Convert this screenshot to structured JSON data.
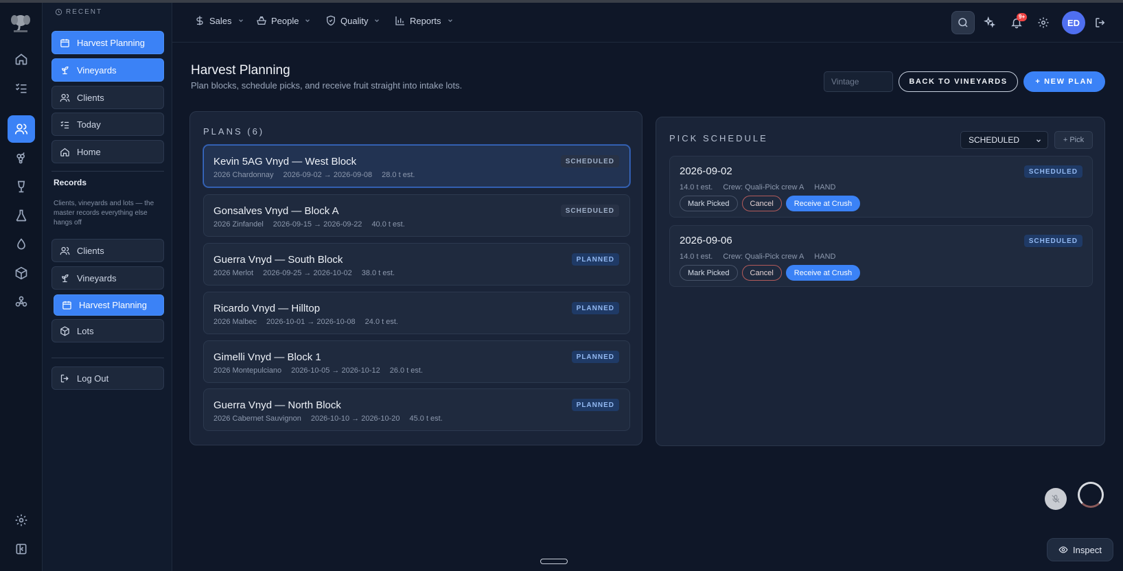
{
  "sidebar": {
    "recent_label": "RECENT",
    "recent_items": [
      {
        "label": "Harvest Planning",
        "icon": "calendar-icon"
      },
      {
        "label": "Vineyards",
        "icon": "sprout-icon"
      },
      {
        "label": "Clients",
        "icon": "users-icon"
      },
      {
        "label": "Today",
        "icon": "checklist-icon"
      },
      {
        "label": "Home",
        "icon": "home-icon"
      }
    ],
    "records_title": "Records",
    "records_desc": "Clients, vineyards and lots — the master records everything else hangs off",
    "record_items": [
      {
        "label": "Clients",
        "icon": "users-icon"
      },
      {
        "label": "Vineyards",
        "icon": "sprout-icon"
      },
      {
        "label": "Harvest Planning",
        "icon": "calendar-icon"
      },
      {
        "label": "Lots",
        "icon": "box-icon"
      }
    ],
    "logout_label": "Log Out"
  },
  "topbar": {
    "nav": [
      {
        "label": "Sales",
        "icon": "dollar-icon"
      },
      {
        "label": "People",
        "icon": "briefcase-icon"
      },
      {
        "label": "Quality",
        "icon": "shield-check-icon"
      },
      {
        "label": "Reports",
        "icon": "bar-chart-icon"
      }
    ],
    "notification_count": "9+",
    "avatar_initials": "ED"
  },
  "page": {
    "title": "Harvest Planning",
    "subtitle": "Plan blocks, schedule picks, and receive fruit straight into intake lots.",
    "vintage_placeholder": "Vintage",
    "back_button": "BACK TO VINEYARDS",
    "new_plan_button": "+ NEW PLAN"
  },
  "plans": {
    "heading": "PLANS (6)",
    "items": [
      {
        "name": "Kevin 5AG Vnyd — West Block",
        "variety": "2026 Chardonnay",
        "dates": "2026-09-02 → 2026-09-08",
        "tons": "28.0 t est.",
        "status": "SCHEDULED"
      },
      {
        "name": "Gonsalves Vnyd — Block A",
        "variety": "2026 Zinfandel",
        "dates": "2026-09-15 → 2026-09-22",
        "tons": "40.0 t est.",
        "status": "SCHEDULED"
      },
      {
        "name": "Guerra Vnyd — South Block",
        "variety": "2026 Merlot",
        "dates": "2026-09-25 → 2026-10-02",
        "tons": "38.0 t est.",
        "status": "PLANNED"
      },
      {
        "name": "Ricardo Vnyd — Hilltop",
        "variety": "2026 Malbec",
        "dates": "2026-10-01 → 2026-10-08",
        "tons": "24.0 t est.",
        "status": "PLANNED"
      },
      {
        "name": "Gimelli Vnyd — Block 1",
        "variety": "2026 Montepulciano",
        "dates": "2026-10-05 → 2026-10-12",
        "tons": "26.0 t est.",
        "status": "PLANNED"
      },
      {
        "name": "Guerra Vnyd — North Block",
        "variety": "2026 Cabernet Sauvignon",
        "dates": "2026-10-10 → 2026-10-20",
        "tons": "45.0 t est.",
        "status": "PLANNED"
      }
    ]
  },
  "schedule": {
    "heading": "PICK SCHEDULE",
    "filter_value": "SCHEDULED",
    "add_pick": "+ Pick",
    "picks": [
      {
        "date": "2026-09-02",
        "tons": "14.0 t est.",
        "crew": "Crew: Quali-Pick crew A",
        "method": "HAND",
        "status": "SCHEDULED",
        "actions": [
          "Mark Picked",
          "Cancel",
          "Receive at Crush"
        ]
      },
      {
        "date": "2026-09-06",
        "tons": "14.0 t est.",
        "crew": "Crew: Quali-Pick crew A",
        "method": "HAND",
        "status": "SCHEDULED",
        "actions": [
          "Mark Picked",
          "Cancel",
          "Receive at Crush"
        ]
      }
    ]
  },
  "widgets": {
    "inspect_label": "Inspect"
  },
  "colors": {
    "accent": "#3b82f6",
    "background": "#0f1728",
    "panel": "#1a2438",
    "danger": "#ef4444"
  }
}
